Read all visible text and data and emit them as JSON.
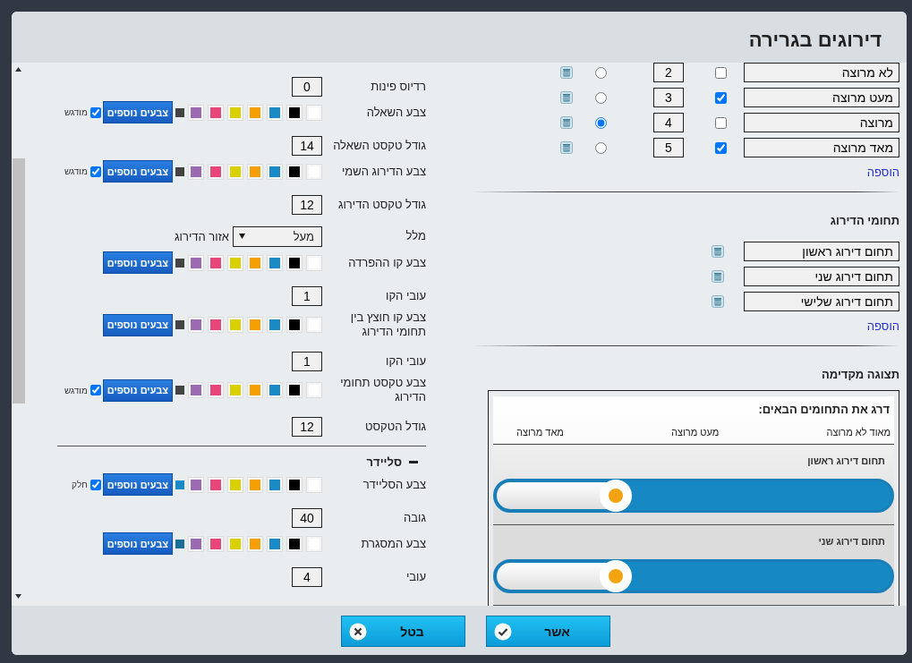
{
  "dialog": {
    "title": "דירוגים בגרירה"
  },
  "settings": [
    {
      "kind": "number",
      "label": "רדיוס פינות",
      "value": "0"
    },
    {
      "kind": "color",
      "label": "צבע השאלה",
      "swatches": [
        {
          "color": "#ffffff"
        },
        {
          "color": "#000000"
        },
        {
          "color": "#1a8ac6"
        },
        {
          "color": "#f5a000"
        },
        {
          "color": "#d9d000"
        },
        {
          "color": "#e8457a"
        },
        {
          "color": "#9a6bb0"
        }
      ],
      "current": {
        "color": "#444444"
      },
      "button": "צבעים נוספים",
      "toggle": {
        "label": "מודגש",
        "checked": true
      }
    },
    {
      "kind": "number",
      "label": "גודל טקסט השאלה",
      "value": "14"
    },
    {
      "kind": "color",
      "label": "צבע הדירוג השמי",
      "swatches": [
        {
          "color": "#ffffff"
        },
        {
          "color": "#000000"
        },
        {
          "color": "#1a8ac6"
        },
        {
          "color": "#f5a000"
        },
        {
          "color": "#d9d000"
        },
        {
          "color": "#e8457a"
        },
        {
          "color": "#9a6bb0"
        }
      ],
      "current": {
        "color": "#444444"
      },
      "button": "צבעים נוספים",
      "toggle": {
        "label": "מודגש",
        "checked": true
      }
    },
    {
      "kind": "number",
      "label": "גודל טקסט הדירוג",
      "value": "12"
    },
    {
      "kind": "select",
      "label": "מלל",
      "value": "מעל",
      "after": "אזור הדירוג"
    },
    {
      "kind": "color",
      "label": "צבע קו ההפרדה",
      "swatches": [
        {
          "color": "#ffffff"
        },
        {
          "color": "#000000"
        },
        {
          "color": "#1a8ac6"
        },
        {
          "color": "#f5a000"
        },
        {
          "color": "#d9d000"
        },
        {
          "color": "#e8457a"
        },
        {
          "color": "#9a6bb0"
        }
      ],
      "current": {
        "color": "#444444"
      },
      "button": "צבעים נוספים"
    },
    {
      "kind": "number",
      "label": "עובי הקו",
      "value": "1"
    },
    {
      "kind": "color",
      "label": "צבע קו חוצץ בין תחומי הדירוג",
      "swatches": [
        {
          "color": "#ffffff"
        },
        {
          "color": "#000000"
        },
        {
          "color": "#1a8ac6"
        },
        {
          "color": "#f5a000"
        },
        {
          "color": "#d9d000"
        },
        {
          "color": "#e8457a"
        },
        {
          "color": "#9a6bb0"
        }
      ],
      "current": {
        "color": "#444444"
      },
      "button": "צבעים נוספים"
    },
    {
      "kind": "number",
      "label": "עובי הקו",
      "value": "1"
    },
    {
      "kind": "color",
      "label": "צבע טקסט תחומי הדירוג",
      "swatches": [
        {
          "color": "#ffffff"
        },
        {
          "color": "#000000"
        },
        {
          "color": "#1a8ac6"
        },
        {
          "color": "#f5a000"
        },
        {
          "color": "#d9d000"
        },
        {
          "color": "#e8457a"
        },
        {
          "color": "#9a6bb0"
        }
      ],
      "current": {
        "color": "#444444"
      },
      "button": "צבעים נוספים",
      "toggle": {
        "label": "מודגש",
        "checked": true
      }
    },
    {
      "kind": "number",
      "label": "גודל הטקסט",
      "value": "12"
    },
    {
      "kind": "section",
      "label": "סליידר",
      "expanded": true
    },
    {
      "kind": "color",
      "label": "צבע הסליידר",
      "swatches": [
        {
          "color": "#ffffff"
        },
        {
          "color": "#000000"
        },
        {
          "color": "#1a8ac6"
        },
        {
          "color": "#f5a000"
        },
        {
          "color": "#d9d000"
        },
        {
          "color": "#e8457a"
        },
        {
          "color": "#9a6bb0"
        }
      ],
      "current": {
        "color": "#1a8ac6"
      },
      "button": "צבעים נוספים",
      "toggle": {
        "label": "חלק",
        "checked": true
      }
    },
    {
      "kind": "number",
      "label": "גובה",
      "value": "40"
    },
    {
      "kind": "color",
      "label": "צבע המסגרת",
      "swatches": [
        {
          "color": "#ffffff"
        },
        {
          "color": "#000000"
        },
        {
          "color": "#1a8ac6"
        },
        {
          "color": "#f5a000"
        },
        {
          "color": "#d9d000"
        },
        {
          "color": "#e8457a"
        },
        {
          "color": "#9a6bb0"
        }
      ],
      "current": {
        "color": "#1a6f96"
      },
      "button": "צבעים נוספים"
    },
    {
      "kind": "number",
      "label": "עובי",
      "value": "4"
    }
  ],
  "scale": {
    "options": [
      {
        "label": "לא מרוצה",
        "checked": false,
        "value": "2",
        "selected": false
      },
      {
        "label": "מעט מרוצה",
        "checked": true,
        "value": "3",
        "selected": false
      },
      {
        "label": "מרוצה",
        "checked": false,
        "value": "4",
        "selected": true
      },
      {
        "label": "מאד מרוצה",
        "checked": true,
        "value": "5",
        "selected": false
      }
    ],
    "add_link": "הוספה"
  },
  "areas": {
    "title": "תחומי הדירוג",
    "items": [
      {
        "label": "תחום דירוג ראשון"
      },
      {
        "label": "תחום דירוג שני"
      },
      {
        "label": "תחום דירוג שלישי"
      }
    ],
    "add_link": "הוספה"
  },
  "preview": {
    "title": "תצוגה מקדימה",
    "instruction": "דרג את התחומים הבאים:",
    "scale_labels": [
      "מאוד לא מרוצה",
      "מעט מרוצה",
      "מאד מרוצה"
    ],
    "items": [
      {
        "label": "תחום דירוג ראשון",
        "level": 0.7
      },
      {
        "label": "תחום דירוג שני",
        "level": 0.7
      }
    ]
  },
  "buttons": [
    {
      "kind": "confirm",
      "label": "אשר"
    },
    {
      "kind": "cancel",
      "label": "בטל"
    }
  ]
}
